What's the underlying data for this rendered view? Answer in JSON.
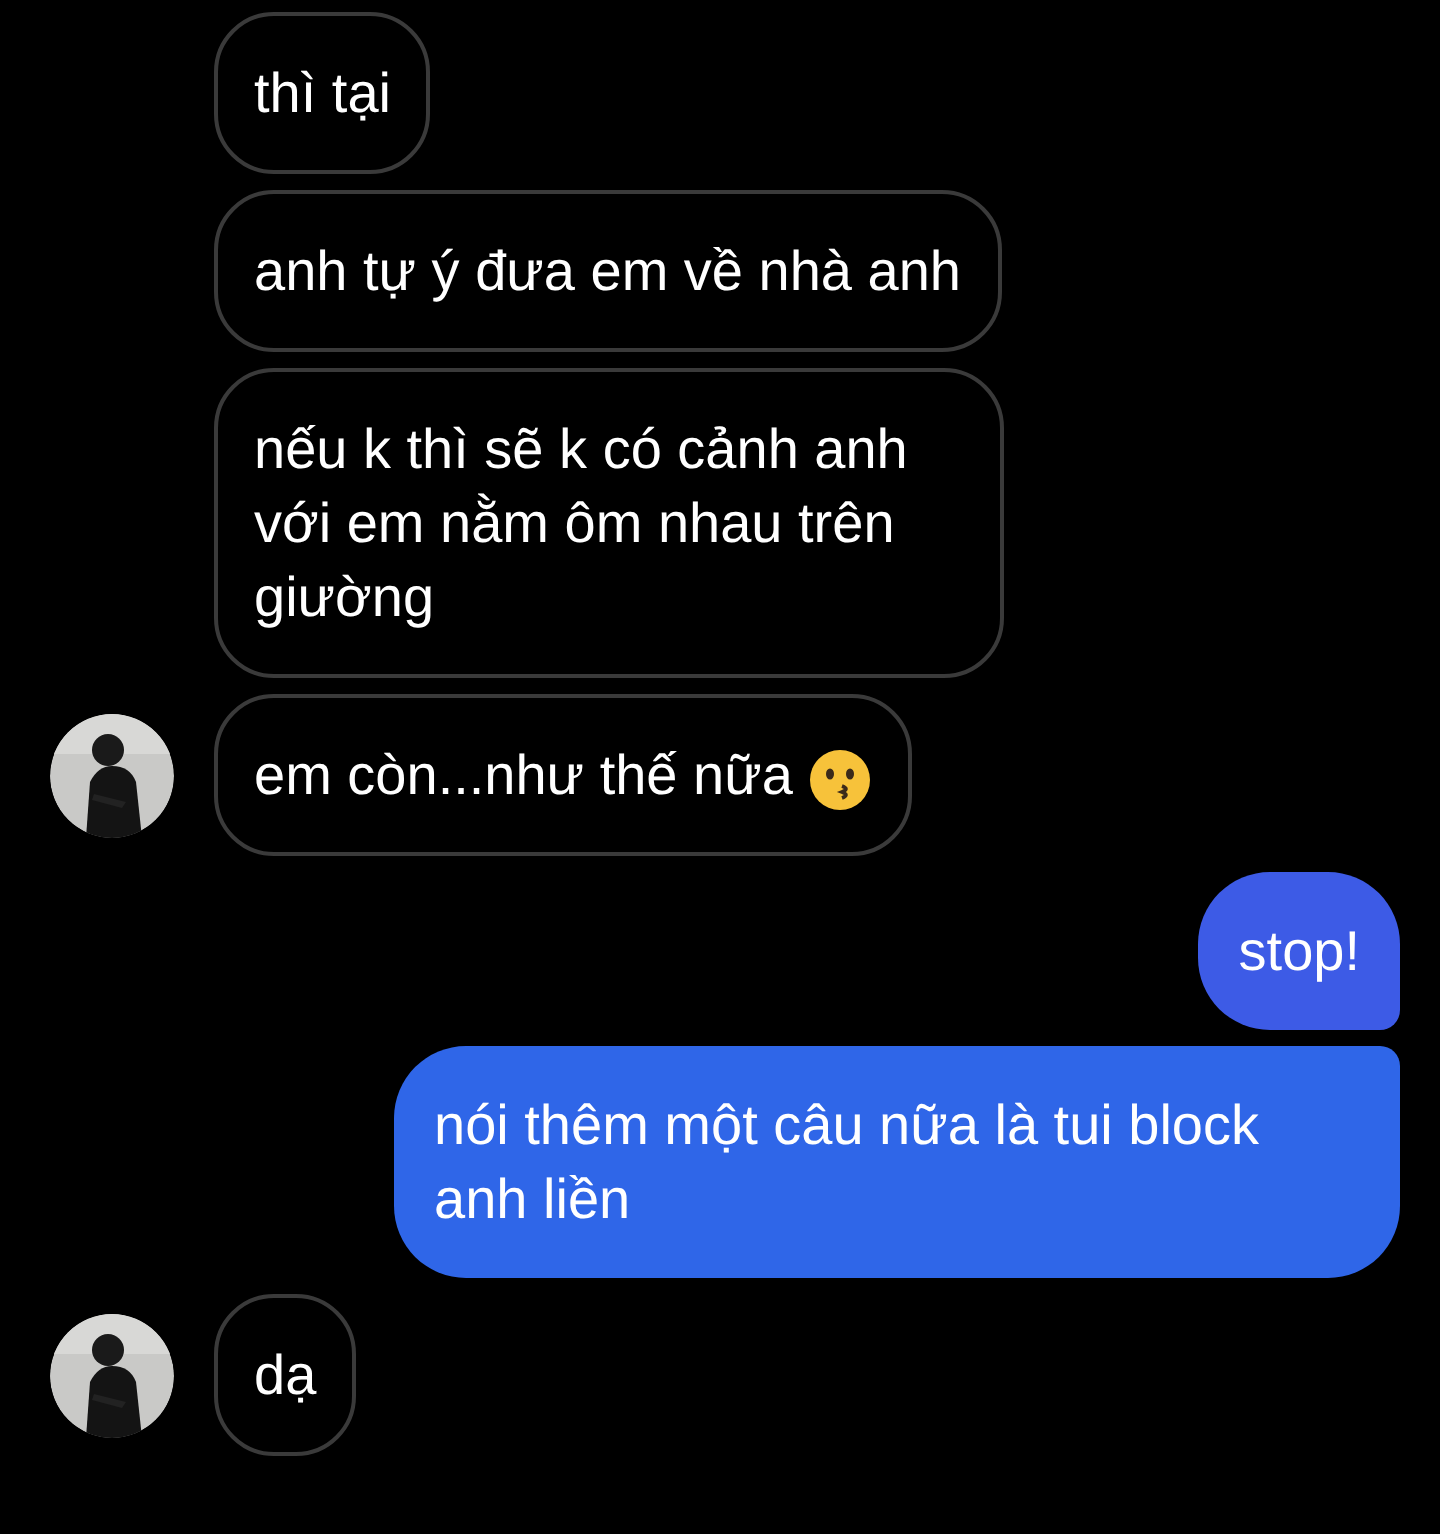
{
  "messages": [
    {
      "kind": "received",
      "text": "thì tại",
      "avatar": false,
      "emoji_icon": false
    },
    {
      "kind": "received",
      "text": "anh tự ý đưa em về nhà anh",
      "avatar": false,
      "emoji_icon": false
    },
    {
      "kind": "received",
      "text": "nếu k thì sẽ k có cảnh anh với em nằm ôm nhau trên giường",
      "avatar": false,
      "emoji_icon": false
    },
    {
      "kind": "received",
      "text": "em còn...như thế nữa",
      "avatar": true,
      "emoji_icon": true
    },
    {
      "kind": "sent",
      "text": "stop!"
    },
    {
      "kind": "sent",
      "text": "nói thêm một câu nữa là tui block anh liền"
    },
    {
      "kind": "received",
      "text": "dạ",
      "avatar": true,
      "emoji_icon": false
    }
  ]
}
